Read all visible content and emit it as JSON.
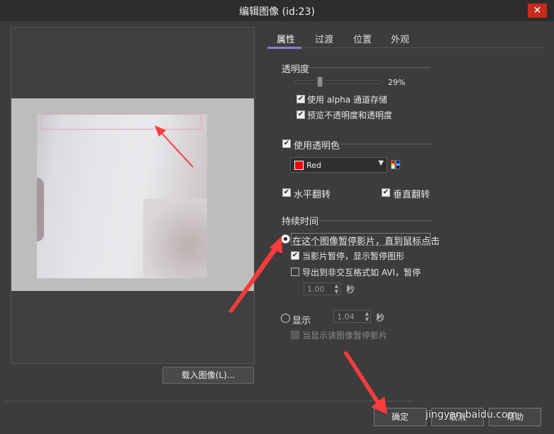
{
  "window": {
    "title": "编辑图像 (id:23)",
    "close_label": "✕"
  },
  "preview": {
    "load_button": "载入图像(L)..."
  },
  "tabs": [
    {
      "label": "属性",
      "active": true
    },
    {
      "label": "过渡",
      "active": false
    },
    {
      "label": "位置",
      "active": false
    },
    {
      "label": "外观",
      "active": false
    }
  ],
  "transparency": {
    "section_title": "透明度",
    "value_percent": 29,
    "value_label": "29%",
    "alpha_channel_label": "使用 alpha 通道存储",
    "alpha_channel_checked": true,
    "preview_label": "预览不透明度和透明度",
    "preview_checked": true
  },
  "transparent_color": {
    "label": "使用透明色",
    "checked": true,
    "color_name": "Red",
    "color_hex": "#ff0000"
  },
  "flip": {
    "horizontal_label": "水平翻转",
    "horizontal_checked": true,
    "vertical_label": "垂直翻转",
    "vertical_checked": true
  },
  "duration": {
    "section_title": "持续时间",
    "option_pause_label": "在这个图像暂停影片，直到鼠标点击",
    "option_pause_selected": true,
    "show_pause_graphic_label": "当影片暂停，显示暂停图形",
    "show_pause_graphic_checked": true,
    "export_pause_label": "导出到非交互格式如 AVI，暂停",
    "export_pause_checked": false,
    "export_seconds_value": "1.00",
    "seconds_unit": "秒",
    "option_show_label": "显示",
    "option_show_selected": false,
    "show_seconds_value": "1.04",
    "pause_while_shown_label": "当显示该图像暂停影片",
    "pause_while_shown_checked": false
  },
  "buttons": {
    "ok": "确定",
    "cancel": "取消",
    "help": "帮助"
  },
  "watermark": "jingyan.baidu.com"
}
